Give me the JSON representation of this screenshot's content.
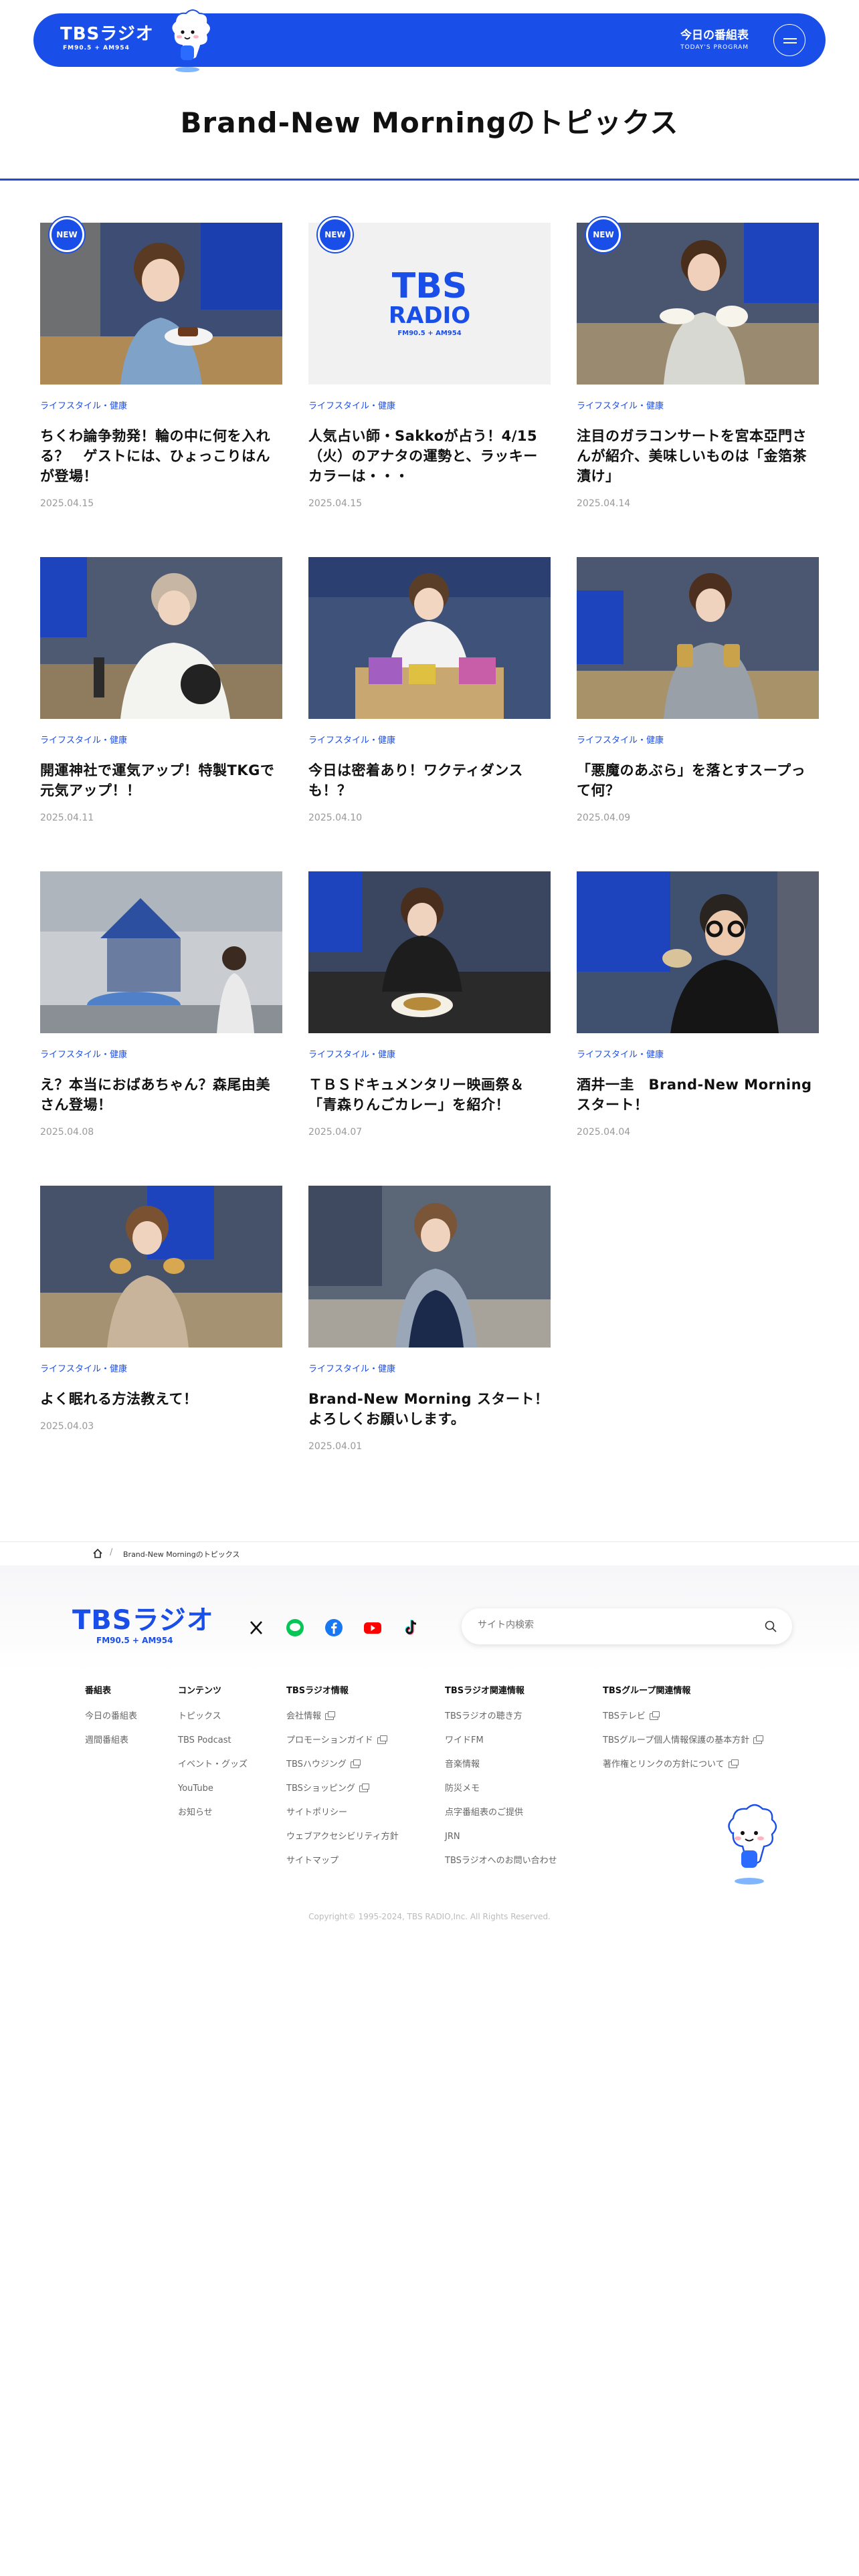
{
  "header": {
    "logo_main": "TBSラジオ",
    "logo_sub": "FM90.5 + AM954",
    "program_jp": "今日の番組表",
    "program_en": "TODAY'S PROGRAM"
  },
  "page_title": "Brand-New Morningのトピックス",
  "badge_new": "NEW",
  "cards": [
    {
      "category": "ライフスタイル・健康",
      "title": "ちくわ論争勃発！輪の中に何を入れる？　ゲストには、ひょっこりはんが登場！",
      "date": "2025.04.15",
      "new": true
    },
    {
      "category": "ライフスタイル・健康",
      "title": "人気占い師・Sakkoが占う！4/15（火）のアナタの運勢と、ラッキーカラーは・・・",
      "date": "2025.04.15",
      "new": true,
      "thumb_logo": "TBS",
      "thumb_logo2": "RADIO",
      "thumb_logo3": "FM90.5 + AM954"
    },
    {
      "category": "ライフスタイル・健康",
      "title": "注目のガラコンサートを宮本亞門さんが紹介、美味しいものは「金箔茶漬け」",
      "date": "2025.04.14",
      "new": true
    },
    {
      "category": "ライフスタイル・健康",
      "title": "開運神社で運気アップ！特製TKGで元気アップ！！",
      "date": "2025.04.11",
      "new": false
    },
    {
      "category": "ライフスタイル・健康",
      "title": "今日は密着あり！ワクティダンスも！？",
      "date": "2025.04.10",
      "new": false
    },
    {
      "category": "ライフスタイル・健康",
      "title": "「悪魔のあぶら」を落とすスープって何？",
      "date": "2025.04.09",
      "new": false
    },
    {
      "category": "ライフスタイル・健康",
      "title": "え？本当におばあちゃん？森尾由美さん登場！",
      "date": "2025.04.08",
      "new": false
    },
    {
      "category": "ライフスタイル・健康",
      "title": "ＴＢＳドキュメンタリー映画祭＆「青森りんごカレー」を紹介！",
      "date": "2025.04.07",
      "new": false
    },
    {
      "category": "ライフスタイル・健康",
      "title": "酒井一圭　Brand-New Morningスタート！",
      "date": "2025.04.04",
      "new": false
    },
    {
      "category": "ライフスタイル・健康",
      "title": "よく眠れる方法教えて！",
      "date": "2025.04.03",
      "new": false
    },
    {
      "category": "ライフスタイル・健康",
      "title": "Brand-New Morning スタート！よろしくお願いします。",
      "date": "2025.04.01",
      "new": false
    }
  ],
  "breadcrumb": {
    "current": "Brand-New Morningのトピックス"
  },
  "footer": {
    "logo_main": "TBSラジオ",
    "logo_sub": "FM90.5 + AM954",
    "search_placeholder": "サイト内検索",
    "columns": [
      {
        "heading": "番組表",
        "items": [
          {
            "label": "今日の番組表"
          },
          {
            "label": "週間番組表"
          }
        ]
      },
      {
        "heading": "コンテンツ",
        "items": [
          {
            "label": "トピックス"
          },
          {
            "label": "TBS Podcast"
          },
          {
            "label": "イベント・グッズ"
          },
          {
            "label": "YouTube"
          },
          {
            "label": "お知らせ"
          }
        ]
      },
      {
        "heading": "TBSラジオ情報",
        "items": [
          {
            "label": "会社情報",
            "ext": true
          },
          {
            "label": "プロモーションガイド",
            "ext": true
          },
          {
            "label": "TBSハウジング",
            "ext": true
          },
          {
            "label": "TBSショッピング",
            "ext": true
          },
          {
            "label": "サイトポリシー"
          },
          {
            "label": "ウェブアクセシビリティ方針"
          },
          {
            "label": "サイトマップ"
          }
        ]
      },
      {
        "heading": "TBSラジオ関連情報",
        "items": [
          {
            "label": "TBSラジオの聴き方"
          },
          {
            "label": "ワイドFM"
          },
          {
            "label": "音楽情報"
          },
          {
            "label": "防災メモ"
          },
          {
            "label": "点字番組表のご提供"
          },
          {
            "label": "JRN"
          },
          {
            "label": "TBSラジオへのお問い合わせ"
          }
        ]
      },
      {
        "heading": "TBSグループ関連情報",
        "items": [
          {
            "label": "TBSテレビ",
            "ext": true
          },
          {
            "label": "TBSグループ個人情報保護の基本方針",
            "ext": true
          },
          {
            "label": "著作権とリンクの方針について",
            "ext": true
          }
        ]
      }
    ],
    "copyright": "Copyright© 1995-2024, TBS RADIO,Inc. All Rights Reserved."
  },
  "colors": {
    "brand": "#1a4ee8"
  }
}
